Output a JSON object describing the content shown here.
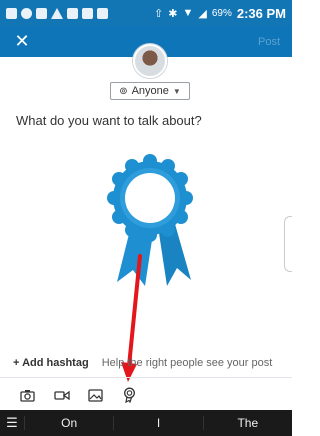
{
  "status_bar": {
    "battery": "69%",
    "time": "2:36 PM",
    "icons": [
      "message-icon",
      "alert-icon",
      "gallery-icon",
      "warning-icon",
      "email-icon",
      "nfc-icon",
      "tool-icon",
      "upload-icon",
      "bluetooth-icon",
      "wifi-icon",
      "signal-icon"
    ]
  },
  "app_bar": {
    "close_label": "✕",
    "post_label": "Post"
  },
  "visibility": {
    "label": "Anyone"
  },
  "composer": {
    "prompt": "What do you want to talk about?"
  },
  "hashtag": {
    "add_label": "+ Add hashtag",
    "help_text": "Help the right people see your post"
  },
  "toolbar": {
    "items": [
      "camera-icon",
      "video-icon",
      "image-icon",
      "celebrate-icon"
    ]
  },
  "nav_bar": {
    "menu_glyph": "☰",
    "segments": [
      "On",
      "I",
      "The"
    ]
  },
  "colors": {
    "primary_blue": "#0d75b8",
    "status_blue": "#1276b5",
    "ribbon_blue": "#1e8fd0",
    "arrow_red": "#e3161c"
  }
}
